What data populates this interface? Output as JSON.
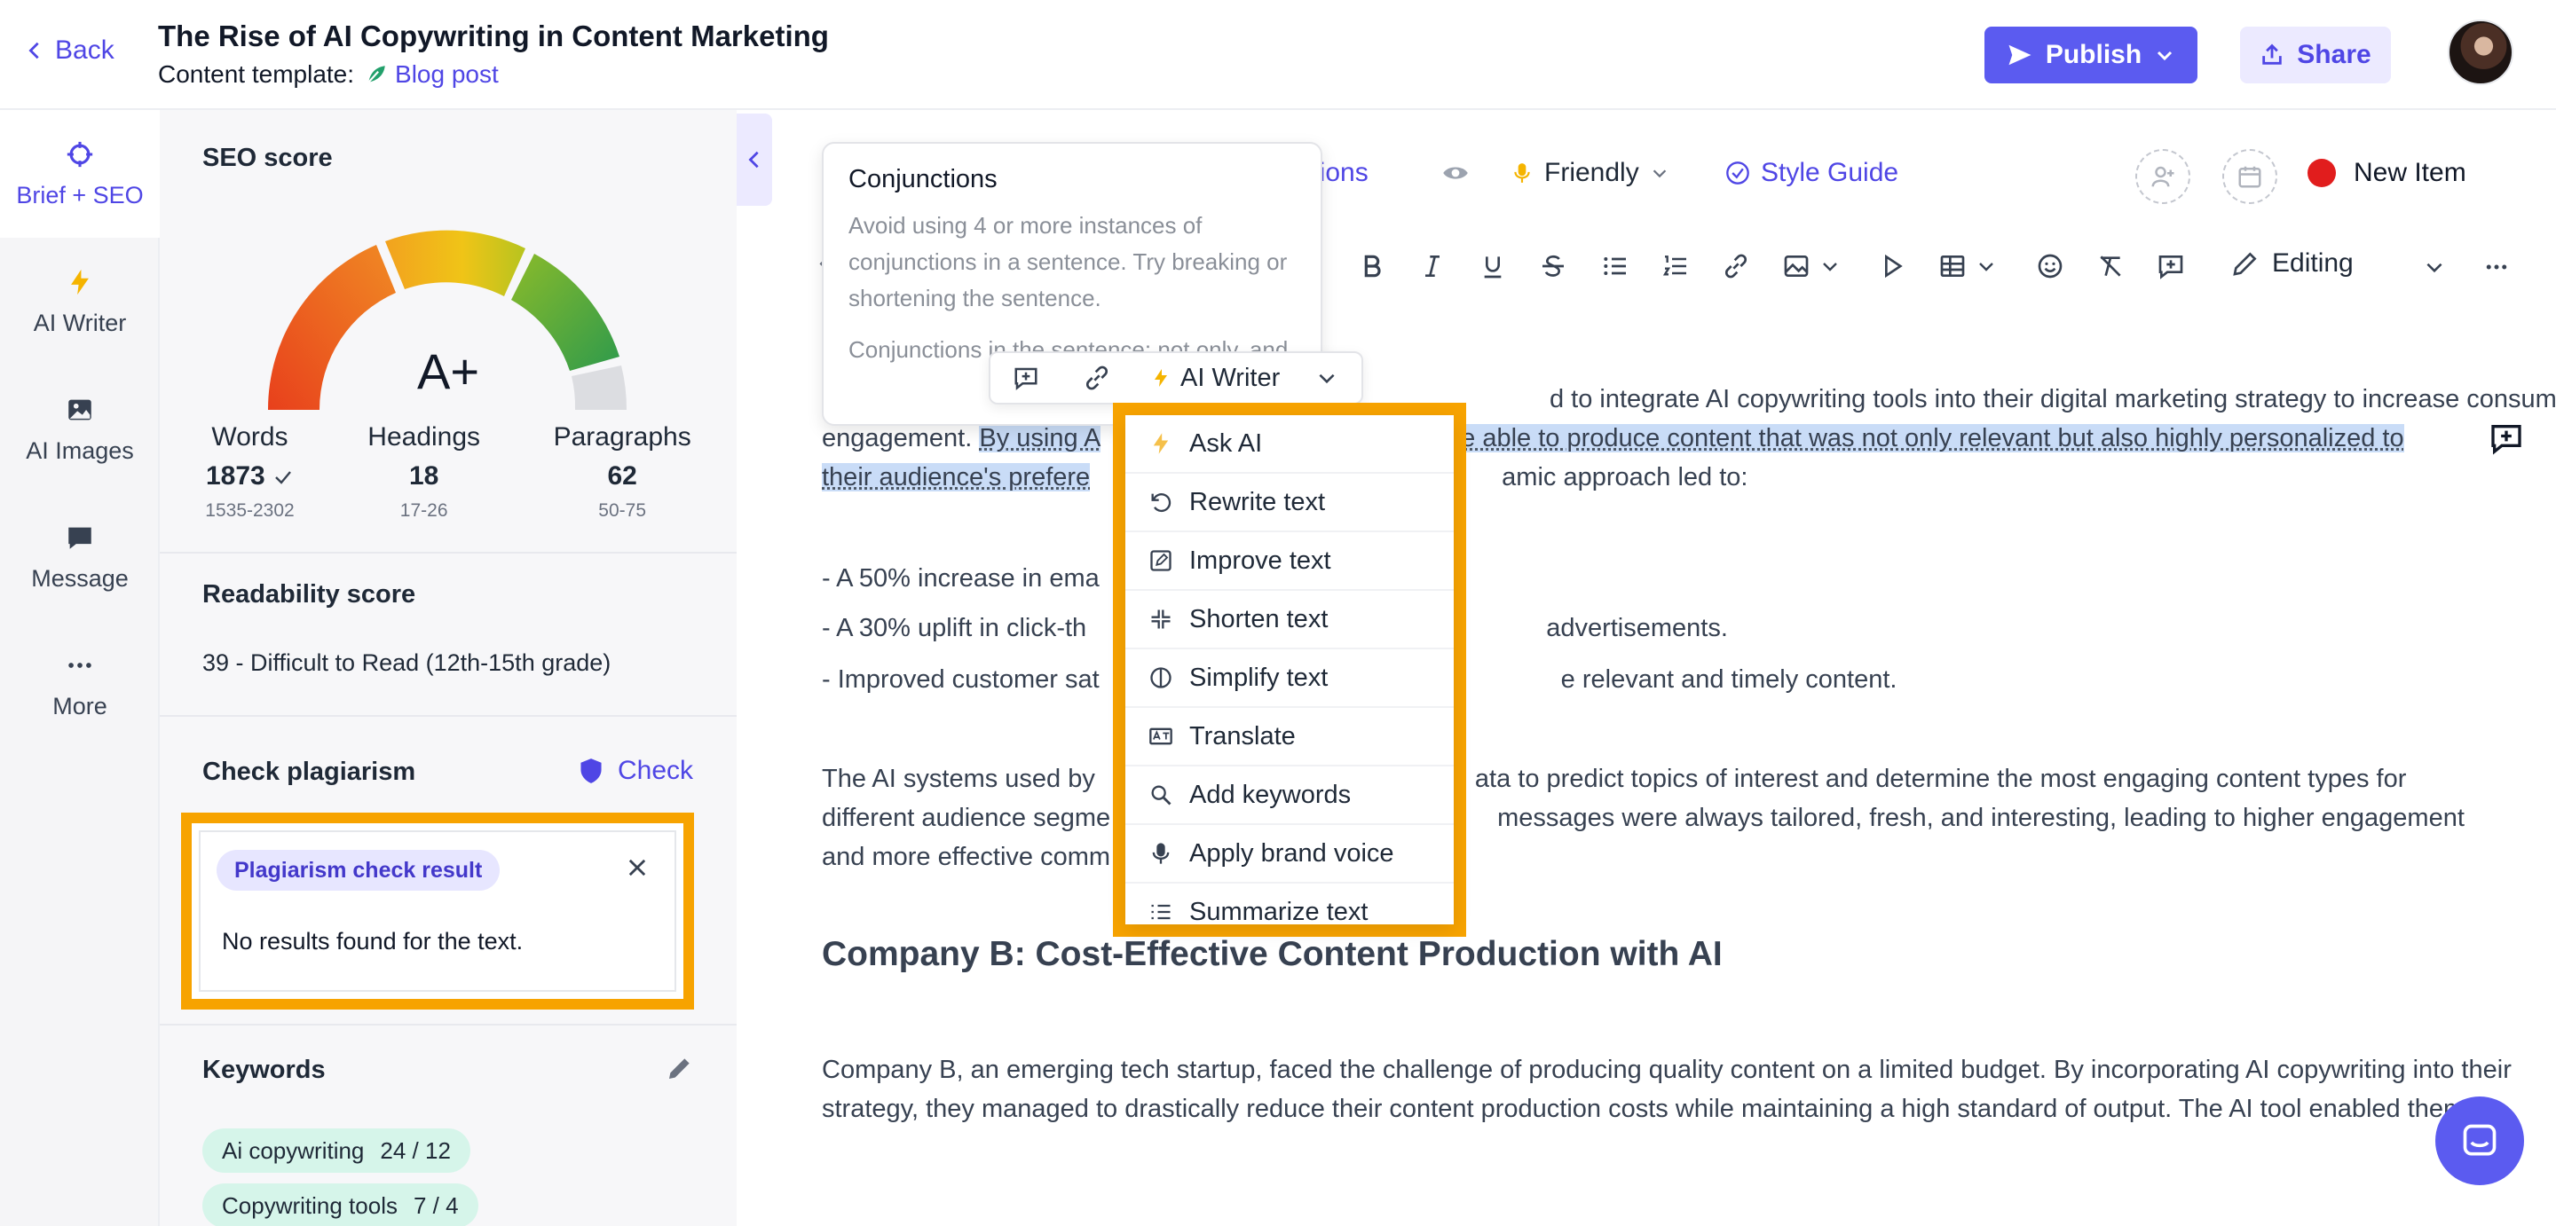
{
  "header": {
    "back_label": "Back",
    "title": "The Rise of AI Copywriting in Content Marketing",
    "template_label": "Content template:",
    "template_name": "Blog post",
    "publish_label": "Publish",
    "share_label": "Share"
  },
  "rail": {
    "items": [
      {
        "label": "Brief + SEO",
        "icon": "crosshair-icon"
      },
      {
        "label": "AI Writer",
        "icon": "bolt-icon"
      },
      {
        "label": "AI Images",
        "icon": "image-icon"
      },
      {
        "label": "Message",
        "icon": "message-icon"
      },
      {
        "label": "More",
        "icon": "more-icon"
      }
    ]
  },
  "seo": {
    "title": "SEO score",
    "grade": "A+",
    "words_label": "Words",
    "words_value": "1873",
    "words_range": "1535-2302",
    "headings_label": "Headings",
    "headings_value": "18",
    "headings_range": "17-26",
    "paragraphs_label": "Paragraphs",
    "paragraphs_value": "62",
    "paragraphs_range": "50-75"
  },
  "readability": {
    "title": "Readability score",
    "value": "39 - Difficult to Read (12th-15th grade)"
  },
  "plagiarism": {
    "title": "Check plagiarism",
    "check_label": "Check",
    "result_pill": "Plagiarism check result",
    "result_text": "No results found for the text."
  },
  "keywords": {
    "title": "Keywords",
    "items": [
      {
        "name": "Ai copywriting",
        "count": "24 / 12"
      },
      {
        "name": "Copywriting tools",
        "count": "7 / 4"
      }
    ]
  },
  "editor_bar": {
    "versions_label": "versions",
    "tone_label": "Friendly",
    "style_guide_label": "Style Guide",
    "new_item_label": "New Item",
    "editing_label": "Editing"
  },
  "tooltip": {
    "title": "Conjunctions",
    "body": "Avoid using 4 or more instances of conjunctions in a sentence. Try breaking or shortening the sentence.",
    "sub": "Conjunctions in the sentence: not only, and"
  },
  "inline_toolbar": {
    "ai_writer_label": "AI Writer"
  },
  "ai_menu": {
    "items": [
      {
        "label": "Ask AI",
        "icon": "bolt-icon"
      },
      {
        "label": "Rewrite text",
        "icon": "rewrite-icon"
      },
      {
        "label": "Improve text",
        "icon": "edit-icon"
      },
      {
        "label": "Shorten text",
        "icon": "shrink-icon"
      },
      {
        "label": "Simplify text",
        "icon": "simplify-icon"
      },
      {
        "label": "Translate",
        "icon": "translate-icon"
      },
      {
        "label": "Add keywords",
        "icon": "keyword-icon"
      },
      {
        "label": "Apply brand voice",
        "icon": "mic-icon"
      },
      {
        "label": "Summarize text",
        "icon": "list-icon"
      }
    ]
  },
  "content": {
    "p1_a": "d to integrate AI copywriting tools into their digital marketing strategy to increase consumer",
    "p1_b_pre": "engagement. ",
    "p1_b_hl1": "By using A",
    "p1_b_hl2": "ere able to produce content that was not only relevant but also highly personalized to",
    "p1_c_hl": "their audience's prefere",
    "p1_c_rest": "amic approach led to:",
    "b1": "- A 50% increase in ema",
    "b2a": "- A 30% uplift in click-th",
    "b2b": "advertisements.",
    "b3a": "- Improved customer sat",
    "b3b": "e relevant and timely content.",
    "p2_a1": "The AI systems used by ",
    "p2_a2": "ata to predict topics of interest and determine the most engaging content types for",
    "p2_b1": "different audience segme",
    "p2_b2": "messages were always tailored, fresh, and interesting, leading to higher engagement",
    "p2_c": "and more effective comm",
    "h2": "Company B: Cost-Effective Content Production with AI",
    "p3": "Company B, an emerging tech startup, faced the challenge of producing quality content on a limited budget. By incorporating AI copywriting into their strategy, they managed to drastically reduce their content production costs while maintaining a high standard of output. The AI tool enabled them to:"
  },
  "colors": {
    "accent": "#5b5bf0",
    "highlight_outline": "#f7a300",
    "selection": "#c9dcf7",
    "new_item_dot": "#e11d1d"
  }
}
